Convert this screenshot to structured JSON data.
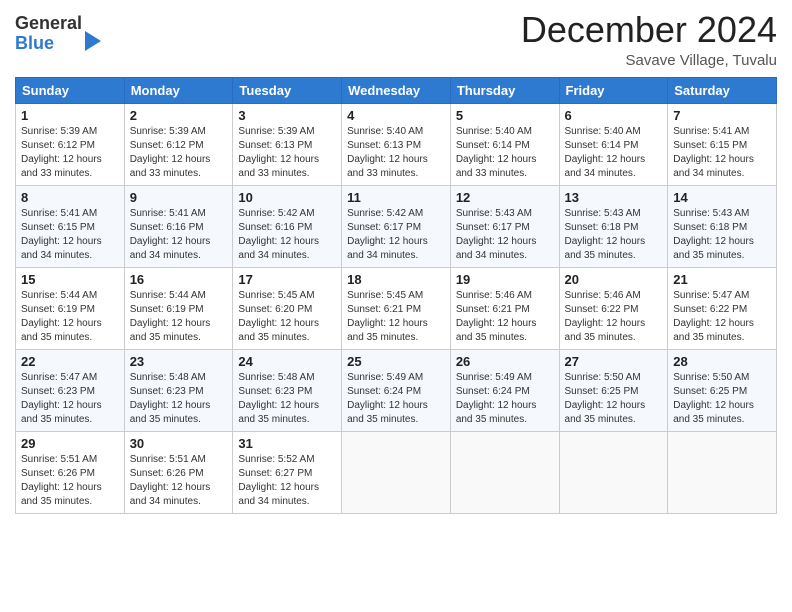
{
  "header": {
    "logo_general": "General",
    "logo_blue": "Blue",
    "month_title": "December 2024",
    "location": "Savave Village, Tuvalu"
  },
  "days_of_week": [
    "Sunday",
    "Monday",
    "Tuesday",
    "Wednesday",
    "Thursday",
    "Friday",
    "Saturday"
  ],
  "weeks": [
    [
      {
        "day": "1",
        "info": "Sunrise: 5:39 AM\nSunset: 6:12 PM\nDaylight: 12 hours\nand 33 minutes."
      },
      {
        "day": "2",
        "info": "Sunrise: 5:39 AM\nSunset: 6:12 PM\nDaylight: 12 hours\nand 33 minutes."
      },
      {
        "day": "3",
        "info": "Sunrise: 5:39 AM\nSunset: 6:13 PM\nDaylight: 12 hours\nand 33 minutes."
      },
      {
        "day": "4",
        "info": "Sunrise: 5:40 AM\nSunset: 6:13 PM\nDaylight: 12 hours\nand 33 minutes."
      },
      {
        "day": "5",
        "info": "Sunrise: 5:40 AM\nSunset: 6:14 PM\nDaylight: 12 hours\nand 33 minutes."
      },
      {
        "day": "6",
        "info": "Sunrise: 5:40 AM\nSunset: 6:14 PM\nDaylight: 12 hours\nand 34 minutes."
      },
      {
        "day": "7",
        "info": "Sunrise: 5:41 AM\nSunset: 6:15 PM\nDaylight: 12 hours\nand 34 minutes."
      }
    ],
    [
      {
        "day": "8",
        "info": "Sunrise: 5:41 AM\nSunset: 6:15 PM\nDaylight: 12 hours\nand 34 minutes."
      },
      {
        "day": "9",
        "info": "Sunrise: 5:41 AM\nSunset: 6:16 PM\nDaylight: 12 hours\nand 34 minutes."
      },
      {
        "day": "10",
        "info": "Sunrise: 5:42 AM\nSunset: 6:16 PM\nDaylight: 12 hours\nand 34 minutes."
      },
      {
        "day": "11",
        "info": "Sunrise: 5:42 AM\nSunset: 6:17 PM\nDaylight: 12 hours\nand 34 minutes."
      },
      {
        "day": "12",
        "info": "Sunrise: 5:43 AM\nSunset: 6:17 PM\nDaylight: 12 hours\nand 34 minutes."
      },
      {
        "day": "13",
        "info": "Sunrise: 5:43 AM\nSunset: 6:18 PM\nDaylight: 12 hours\nand 35 minutes."
      },
      {
        "day": "14",
        "info": "Sunrise: 5:43 AM\nSunset: 6:18 PM\nDaylight: 12 hours\nand 35 minutes."
      }
    ],
    [
      {
        "day": "15",
        "info": "Sunrise: 5:44 AM\nSunset: 6:19 PM\nDaylight: 12 hours\nand 35 minutes."
      },
      {
        "day": "16",
        "info": "Sunrise: 5:44 AM\nSunset: 6:19 PM\nDaylight: 12 hours\nand 35 minutes."
      },
      {
        "day": "17",
        "info": "Sunrise: 5:45 AM\nSunset: 6:20 PM\nDaylight: 12 hours\nand 35 minutes."
      },
      {
        "day": "18",
        "info": "Sunrise: 5:45 AM\nSunset: 6:21 PM\nDaylight: 12 hours\nand 35 minutes."
      },
      {
        "day": "19",
        "info": "Sunrise: 5:46 AM\nSunset: 6:21 PM\nDaylight: 12 hours\nand 35 minutes."
      },
      {
        "day": "20",
        "info": "Sunrise: 5:46 AM\nSunset: 6:22 PM\nDaylight: 12 hours\nand 35 minutes."
      },
      {
        "day": "21",
        "info": "Sunrise: 5:47 AM\nSunset: 6:22 PM\nDaylight: 12 hours\nand 35 minutes."
      }
    ],
    [
      {
        "day": "22",
        "info": "Sunrise: 5:47 AM\nSunset: 6:23 PM\nDaylight: 12 hours\nand 35 minutes."
      },
      {
        "day": "23",
        "info": "Sunrise: 5:48 AM\nSunset: 6:23 PM\nDaylight: 12 hours\nand 35 minutes."
      },
      {
        "day": "24",
        "info": "Sunrise: 5:48 AM\nSunset: 6:23 PM\nDaylight: 12 hours\nand 35 minutes."
      },
      {
        "day": "25",
        "info": "Sunrise: 5:49 AM\nSunset: 6:24 PM\nDaylight: 12 hours\nand 35 minutes."
      },
      {
        "day": "26",
        "info": "Sunrise: 5:49 AM\nSunset: 6:24 PM\nDaylight: 12 hours\nand 35 minutes."
      },
      {
        "day": "27",
        "info": "Sunrise: 5:50 AM\nSunset: 6:25 PM\nDaylight: 12 hours\nand 35 minutes."
      },
      {
        "day": "28",
        "info": "Sunrise: 5:50 AM\nSunset: 6:25 PM\nDaylight: 12 hours\nand 35 minutes."
      }
    ],
    [
      {
        "day": "29",
        "info": "Sunrise: 5:51 AM\nSunset: 6:26 PM\nDaylight: 12 hours\nand 35 minutes."
      },
      {
        "day": "30",
        "info": "Sunrise: 5:51 AM\nSunset: 6:26 PM\nDaylight: 12 hours\nand 34 minutes."
      },
      {
        "day": "31",
        "info": "Sunrise: 5:52 AM\nSunset: 6:27 PM\nDaylight: 12 hours\nand 34 minutes."
      },
      {
        "day": "",
        "info": ""
      },
      {
        "day": "",
        "info": ""
      },
      {
        "day": "",
        "info": ""
      },
      {
        "day": "",
        "info": ""
      }
    ]
  ]
}
